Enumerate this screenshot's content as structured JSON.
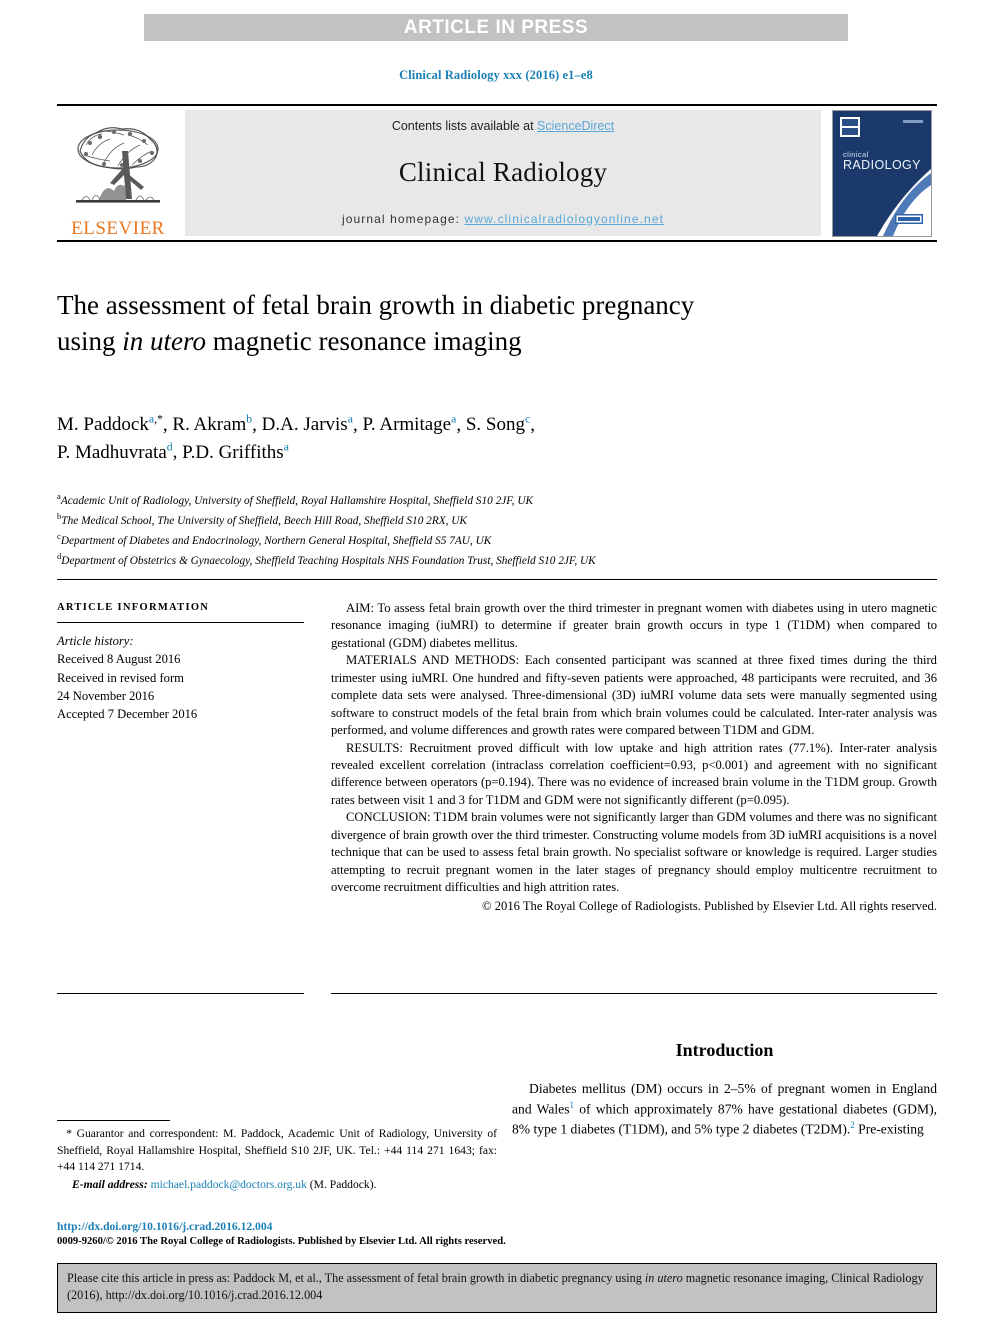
{
  "banner": {
    "label": "ARTICLE IN PRESS"
  },
  "running_head": "Clinical Radiology xxx (2016) e1–e8",
  "masthead": {
    "publisher_logo_name": "elsevier-tree-logo",
    "publisher_word": "ELSEVIER",
    "contents_prefix": "Contents lists available at ",
    "contents_link": "ScienceDirect",
    "journal_title": "Clinical Radiology",
    "homepage_prefix": "journal homepage: ",
    "homepage_url": "www.clinicalradiologyonline.net",
    "cover_line1": "clinical",
    "cover_line2": "RADIOLOGY"
  },
  "article": {
    "title_part1": "The assessment of fetal brain growth in diabetic pregnancy using ",
    "title_italic": "in utero",
    "title_part2": " magnetic resonance imaging",
    "authors": [
      {
        "name": "M. Paddock",
        "mark": "a",
        "corresponding": true
      },
      {
        "name": "R. Akram",
        "mark": "b",
        "corresponding": false
      },
      {
        "name": "D.A. Jarvis",
        "mark": "a",
        "corresponding": false
      },
      {
        "name": "P. Armitage",
        "mark": "a",
        "corresponding": false
      },
      {
        "name": "S. Song",
        "mark": "c",
        "corresponding": false
      },
      {
        "name": "P. Madhuvrata",
        "mark": "d",
        "corresponding": false
      },
      {
        "name": "P.D. Griffiths",
        "mark": "a",
        "corresponding": false
      }
    ],
    "affiliations": [
      {
        "mark": "a",
        "text": "Academic Unit of Radiology, University of Sheffield, Royal Hallamshire Hospital, Sheffield S10 2JF, UK"
      },
      {
        "mark": "b",
        "text": "The Medical School, The University of Sheffield, Beech Hill Road, Sheffield S10 2RX, UK"
      },
      {
        "mark": "c",
        "text": "Department of Diabetes and Endocrinology, Northern General Hospital, Sheffield S5 7AU, UK"
      },
      {
        "mark": "d",
        "text": "Department of Obstetrics & Gynaecology, Sheffield Teaching Hospitals NHS Foundation Trust, Sheffield S10 2JF, UK"
      }
    ]
  },
  "article_information": {
    "heading": "ARTICLE INFORMATION",
    "history_label": "Article history:",
    "history_lines": [
      "Received 8 August 2016",
      "Received in revised form",
      "24 November 2016",
      "Accepted 7 December 2016"
    ]
  },
  "abstract": {
    "aim_label": "AIM:",
    "aim_text": " To assess fetal brain growth over the third trimester in pregnant women with diabetes using in utero magnetic resonance imaging (iuMRI) to determine if greater brain growth occurs in type 1 (T1DM) when compared to gestational (GDM) diabetes mellitus.",
    "methods_label": "MATERIALS AND METHODS:",
    "methods_text": " Each consented participant was scanned at three fixed times during the third trimester using iuMRI. One hundred and fifty-seven patients were approached, 48 participants were recruited, and 36 complete data sets were analysed. Three-dimensional (3D) iuMRI volume data sets were manually segmented using software to construct models of the fetal brain from which brain volumes could be calculated. Inter-rater analysis was performed, and volume differences and growth rates were compared between T1DM and GDM.",
    "results_label": "RESULTS:",
    "results_text": " Recruitment proved difficult with low uptake and high attrition rates (77.1%). Inter-rater analysis revealed excellent correlation (intraclass correlation coefficient=0.93, p<0.001) and agreement with no significant difference between operators (p=0.194). There was no evidence of increased brain volume in the T1DM group. Growth rates between visit 1 and 3 for T1DM and GDM were not significantly different (p=0.095).",
    "conclusion_label": "CONCLUSION:",
    "conclusion_text": " T1DM brain volumes were not significantly larger than GDM volumes and there was no significant divergence of brain growth over the third trimester. Constructing volume models from 3D iuMRI acquisitions is a novel technique that can be used to assess fetal brain growth. No specialist software or knowledge is required. Larger studies attempting to recruit pregnant women in the later stages of pregnancy should employ multicentre recruitment to overcome recruitment difficulties and high attrition rates.",
    "copyright": "© 2016 The Royal College of Radiologists. Published by Elsevier Ltd. All rights reserved."
  },
  "introduction": {
    "heading": "Introduction",
    "paragraph_a": "Diabetes mellitus (DM) occurs in 2–5% of pregnant women in England and Wales",
    "ref1": "1",
    "paragraph_b": " of which approximately 87% have gestational diabetes (GDM), 8% type 1 diabetes (T1DM), and 5% type 2 diabetes (T2DM).",
    "ref2": "2",
    "paragraph_c": " Pre-existing"
  },
  "footnote": {
    "star": "*",
    "correspondence": " Guarantor and correspondent: M. Paddock, Academic Unit of Radiology, University of Sheffield, Royal Hallamshire Hospital, Sheffield S10 2JF, UK. Tel.: +44 114 271 1643; fax: +44 114 271 1714.",
    "email_label": "E-mail address:",
    "email": "michael.paddock@doctors.org.uk",
    "email_suffix": " (M. Paddock)."
  },
  "publisher_footer": {
    "doi": "http://dx.doi.org/10.1016/j.crad.2016.12.004",
    "issn_line": "0009-9260/© 2016 The Royal College of Radiologists. Published by Elsevier Ltd. All rights reserved."
  },
  "cite_box": {
    "text_part1": "Please cite this article in press as: Paddock M, et al., The assessment of fetal brain growth in diabetic pregnancy using ",
    "text_italic": "in utero",
    "text_part2": " magnetic resonance imaging, Clinical Radiology (2016), http://dx.doi.org/10.1016/j.crad.2016.12.004"
  },
  "colors": {
    "link": "#1a7fb5",
    "sciencedirect": "#5aa8d8",
    "elsevier_orange": "#e87722",
    "banner_grey": "#c2c2c2",
    "masthead_grey": "#e8e8e8",
    "cover_navy": "#1b3a6b"
  }
}
